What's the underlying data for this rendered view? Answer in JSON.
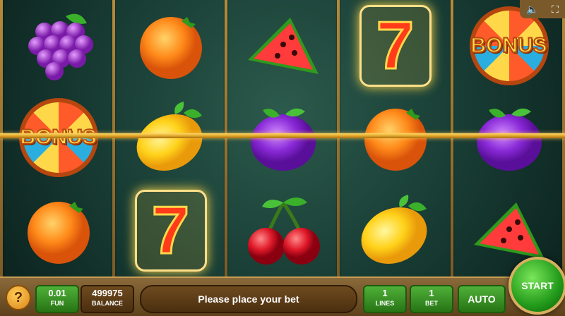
{
  "topbar": {
    "sound_icon": "speaker-icon",
    "fullscreen_icon": "fullscreen-icon"
  },
  "reels": [
    [
      "grapes",
      "bonus",
      "orange"
    ],
    [
      "orange",
      "lemon",
      "seven"
    ],
    [
      "watermelon",
      "plum",
      "cherry"
    ],
    [
      "seven",
      "orange",
      "lemon"
    ],
    [
      "bonus",
      "plum",
      "watermelon"
    ]
  ],
  "bonus_text": "BONUS",
  "seven_text": "7",
  "controls": {
    "help_label": "?",
    "fun_value": "0.01",
    "fun_label": "FUN",
    "balance_value": "499975",
    "balance_label": "BALANCE",
    "message": "Please place your bet",
    "lines_value": "1",
    "lines_label": "LINES",
    "bet_value": "1",
    "bet_label": "BET",
    "auto_label": "AUTO",
    "start_label": "START"
  },
  "colors": {
    "accent": "#e0a92a",
    "green": "#2f9a1c",
    "brown": "#5c3f1a"
  }
}
